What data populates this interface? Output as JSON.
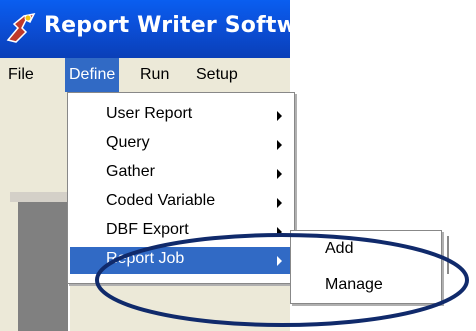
{
  "window": {
    "title": "Report Writer Software"
  },
  "menubar": {
    "items": [
      {
        "label": "File"
      },
      {
        "label": "Define"
      },
      {
        "label": "Run"
      },
      {
        "label": "Setup"
      }
    ]
  },
  "define_menu": {
    "items": [
      {
        "label": "User Report",
        "has_submenu": true
      },
      {
        "label": "Query",
        "has_submenu": true
      },
      {
        "label": "Gather",
        "has_submenu": true
      },
      {
        "label": "Coded Variable",
        "has_submenu": true
      },
      {
        "label": "DBF Export",
        "has_submenu": true
      },
      {
        "label": "Report Job",
        "has_submenu": true,
        "selected": true
      }
    ]
  },
  "report_job_submenu": {
    "items": [
      {
        "label": "Add"
      },
      {
        "label": "Manage"
      }
    ]
  },
  "colors": {
    "titlebar": "#0b4fd8",
    "menu_highlight": "#316ac5",
    "menu_bg": "#ece9d8",
    "annotation_ellipse": "#102a6b"
  },
  "icons": {
    "app_icon": "report-writer-app-icon",
    "submenu_arrow": "submenu-arrow-icon"
  }
}
